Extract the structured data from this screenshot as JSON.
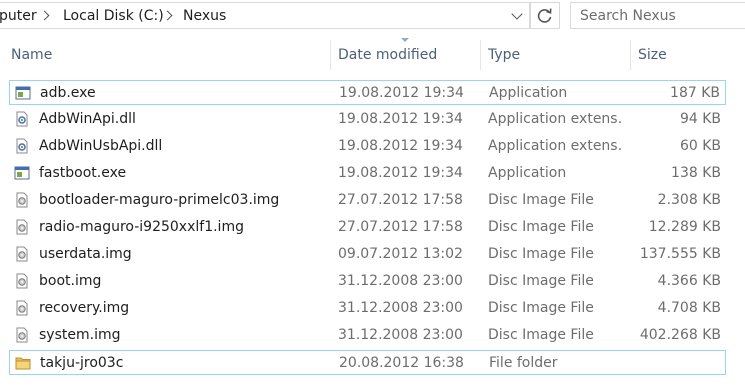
{
  "address": {
    "crumbs": [
      "puter",
      "Local Disk (C:)",
      "Nexus"
    ]
  },
  "search": {
    "placeholder": "Search Nexus"
  },
  "columns": {
    "name": "Name",
    "date": "Date modified",
    "type": "Type",
    "size": "Size"
  },
  "files": [
    {
      "name": "adb.exe",
      "date": "19.08.2012 19:34",
      "type": "Application",
      "size": "187 KB",
      "icon": "application-icon"
    },
    {
      "name": "AdbWinApi.dll",
      "date": "19.08.2012 19:34",
      "type": "Application extens…",
      "size": "94 KB",
      "icon": "dll-icon"
    },
    {
      "name": "AdbWinUsbApi.dll",
      "date": "19.08.2012 19:34",
      "type": "Application extens…",
      "size": "60 KB",
      "icon": "dll-icon"
    },
    {
      "name": "fastboot.exe",
      "date": "19.08.2012 19:34",
      "type": "Application",
      "size": "138 KB",
      "icon": "application-icon"
    },
    {
      "name": "bootloader-maguro-primelc03.img",
      "date": "27.07.2012 17:58",
      "type": "Disc Image File",
      "size": "2.308 KB",
      "icon": "disc-image-icon"
    },
    {
      "name": "radio-maguro-i9250xxlf1.img",
      "date": "27.07.2012 17:58",
      "type": "Disc Image File",
      "size": "12.289 KB",
      "icon": "disc-image-icon"
    },
    {
      "name": "userdata.img",
      "date": "09.07.2012 13:02",
      "type": "Disc Image File",
      "size": "137.555 KB",
      "icon": "disc-image-icon"
    },
    {
      "name": "boot.img",
      "date": "31.12.2008 23:00",
      "type": "Disc Image File",
      "size": "4.366 KB",
      "icon": "disc-image-icon"
    },
    {
      "name": "recovery.img",
      "date": "31.12.2008 23:00",
      "type": "Disc Image File",
      "size": "4.708 KB",
      "icon": "disc-image-icon"
    },
    {
      "name": "system.img",
      "date": "31.12.2008 23:00",
      "type": "Disc Image File",
      "size": "402.268 KB",
      "icon": "disc-image-icon"
    },
    {
      "name": "takju-jro03c",
      "date": "20.08.2012 16:38",
      "type": "File folder",
      "size": "",
      "icon": "folder-icon"
    }
  ],
  "colors": {
    "header_text": "#4c607a",
    "selection_border": "#99d1ff",
    "meta_text": "#6d6d6d"
  }
}
